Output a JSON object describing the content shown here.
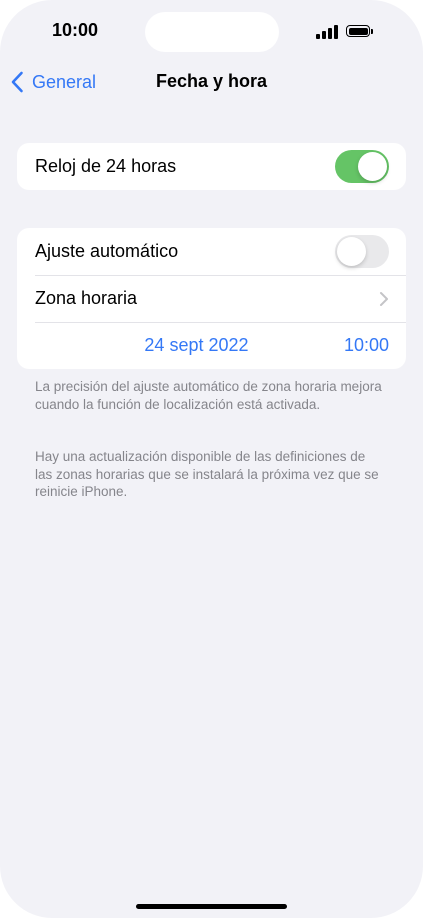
{
  "status_bar": {
    "time": "10:00",
    "signal_icon": "cellular-signal-icon",
    "battery_icon": "battery-full-icon"
  },
  "nav": {
    "back_label": "General",
    "title": "Fecha y hora",
    "accent_color": "#3478f6"
  },
  "clock_group": {
    "label": "Reloj de 24 horas",
    "toggle_on": true
  },
  "auto_group": {
    "auto_label": "Ajuste automático",
    "auto_toggle_on": false,
    "timezone_label": "Zona horaria",
    "date_value": "24 sept 2022",
    "time_value": "10:00"
  },
  "notes": {
    "note1": "La precisión del ajuste automático de zona horaria mejora cuando la función de localización está activada.",
    "note2": "Hay una actualización disponible de las definiciones de las zonas horarias que se instalará la próxima vez que se reinicie iPhone."
  },
  "colors": {
    "toggle_on": "#65c466",
    "toggle_off": "#e9e9eb",
    "background": "#f2f2f7"
  }
}
